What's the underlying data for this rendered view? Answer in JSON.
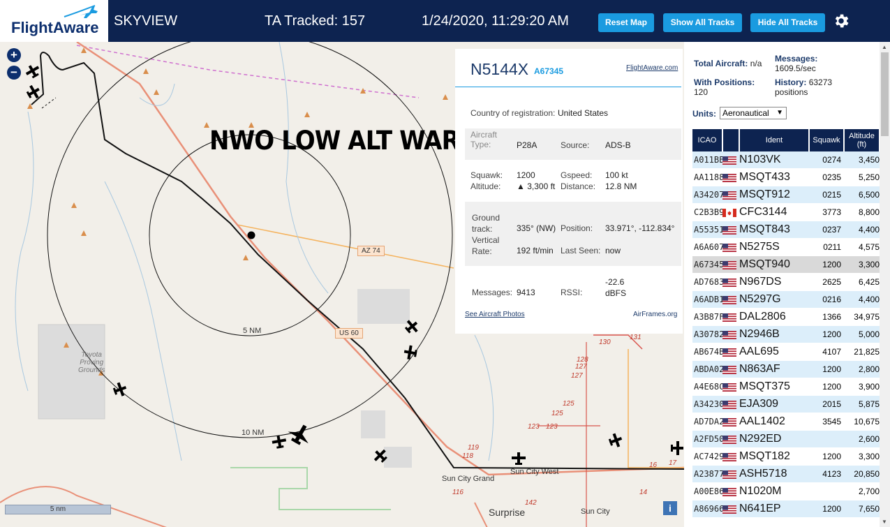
{
  "header": {
    "logo_text": "FlightAware",
    "app_title": "SKYVIEW",
    "tracked_label": "TA Tracked: 157",
    "datetime": "1/24/2020, 11:29:20 AM",
    "reset_map": "Reset Map",
    "show_all": "Show All Tracks",
    "hide_all": "Hide All Tracks"
  },
  "map": {
    "watermark": "NWO LOW ALT WARRIOR",
    "ring_5": "5 NM",
    "ring_10": "10 NM",
    "scale": "5 nm",
    "info_btn": "i",
    "labels": {
      "toyota": "Toyota\nProving\nGrounds",
      "sun_city_grand": "Sun City Grand",
      "sun_city_west": "Sun City West",
      "surprise": "Surprise",
      "sun_city": "Sun City",
      "az74": "AZ 74",
      "us60": "US 60"
    },
    "route_numbers": [
      "130",
      "131",
      "128",
      "127",
      "127",
      "125",
      "125",
      "123",
      "123",
      "119",
      "118",
      "116",
      "142",
      "17",
      "16",
      "14"
    ]
  },
  "aircraft": {
    "callsign": "N5144X",
    "icao": "A67345",
    "link": "FlightAware.com",
    "country_label": "Country of registration:",
    "country": "United States",
    "type_label": "Aircraft Type:",
    "type": "P28A",
    "source_label": "Source:",
    "source": "ADS-B",
    "squawk_label": "Squawk:",
    "squawk": "1200",
    "altitude_label": "Altitude:",
    "altitude": "▲ 3,300 ft",
    "gspeed_label": "Gspeed:",
    "gspeed": "100 kt",
    "distance_label": "Distance:",
    "distance": "12.8 NM",
    "track_label": "Ground track:",
    "track": "335° (NW)",
    "vrate_label": "Vertical Rate:",
    "vrate": "192 ft/min",
    "position_label": "Position:",
    "position": "33.971°, -112.834°",
    "lastseen_label": "Last Seen:",
    "lastseen": "now",
    "messages_label": "Messages:",
    "messages": "9413",
    "rssi_label": "RSSI:",
    "rssi": "-22.6 dBFS",
    "photos_link": "See Aircraft Photos",
    "airframes_link": "AirFrames.org"
  },
  "stats": {
    "total_label": "Total Aircraft:",
    "total": "n/a",
    "messages_label": "Messages:",
    "messages": "1609.5/sec",
    "positions_label": "With Positions:",
    "positions": "120",
    "history_label": "History:",
    "history": "63273 positions",
    "units_label": "Units:",
    "units": "Aeronautical"
  },
  "table": {
    "headers": [
      "ICAO",
      "",
      "Ident",
      "Squawk",
      "Altitude (ft)"
    ],
    "rows": [
      {
        "icao": "A011BE",
        "flag": "us",
        "ident": "N103VK",
        "squawk": "0274",
        "alt": "3,450"
      },
      {
        "icao": "AA1188",
        "flag": "us",
        "ident": "MSQT433",
        "squawk": "0235",
        "alt": "5,250"
      },
      {
        "icao": "A34207",
        "flag": "us",
        "ident": "MSQT912",
        "squawk": "0215",
        "alt": "6,500"
      },
      {
        "icao": "C2B3B9",
        "flag": "ca",
        "ident": "CFC3144",
        "squawk": "3773",
        "alt": "8,800"
      },
      {
        "icao": "A55351",
        "flag": "us",
        "ident": "MSQT843",
        "squawk": "0237",
        "alt": "4,400"
      },
      {
        "icao": "A6A607",
        "flag": "us",
        "ident": "N5275S",
        "squawk": "0211",
        "alt": "4,575"
      },
      {
        "icao": "A67345",
        "flag": "us",
        "ident": "MSQT940",
        "squawk": "1200",
        "alt": "3,300"
      },
      {
        "icao": "AD7683",
        "flag": "us",
        "ident": "N967DS",
        "squawk": "2625",
        "alt": "6,425"
      },
      {
        "icao": "A6ADB1",
        "flag": "us",
        "ident": "N5297G",
        "squawk": "0216",
        "alt": "4,400"
      },
      {
        "icao": "A3B87F",
        "flag": "us",
        "ident": "DAL2806",
        "squawk": "1366",
        "alt": "34,975"
      },
      {
        "icao": "A30782",
        "flag": "us",
        "ident": "N2946B",
        "squawk": "1200",
        "alt": "5,000"
      },
      {
        "icao": "AB674B",
        "flag": "us",
        "ident": "AAL695",
        "squawk": "4107",
        "alt": "21,825"
      },
      {
        "icao": "ABDA02",
        "flag": "us",
        "ident": "N863AF",
        "squawk": "1200",
        "alt": "2,800"
      },
      {
        "icao": "A4E68C",
        "flag": "us",
        "ident": "MSQT375",
        "squawk": "1200",
        "alt": "3,900"
      },
      {
        "icao": "A34230",
        "flag": "us",
        "ident": "EJA309",
        "squawk": "2015",
        "alt": "5,875"
      },
      {
        "icao": "AD7DA2",
        "flag": "us",
        "ident": "AAL1402",
        "squawk": "3545",
        "alt": "10,675"
      },
      {
        "icao": "A2FD50",
        "flag": "us",
        "ident": "N292ED",
        "squawk": "",
        "alt": "2,600"
      },
      {
        "icao": "AC7429",
        "flag": "us",
        "ident": "MSQT182",
        "squawk": "1200",
        "alt": "3,300"
      },
      {
        "icao": "A23877",
        "flag": "us",
        "ident": "ASH5718",
        "squawk": "4123",
        "alt": "20,850"
      },
      {
        "icao": "A00E86",
        "flag": "us",
        "ident": "N1020M",
        "squawk": "",
        "alt": "2,700"
      },
      {
        "icao": "A86966",
        "flag": "us",
        "ident": "N641EP",
        "squawk": "1200",
        "alt": "7,650"
      }
    ],
    "selected_icao": "A67345"
  },
  "colors": {
    "header_bg": "#0d2350",
    "button_bg": "#1a9be0",
    "row_alt": "#dceefa",
    "row_selected": "#d9d9d9"
  }
}
